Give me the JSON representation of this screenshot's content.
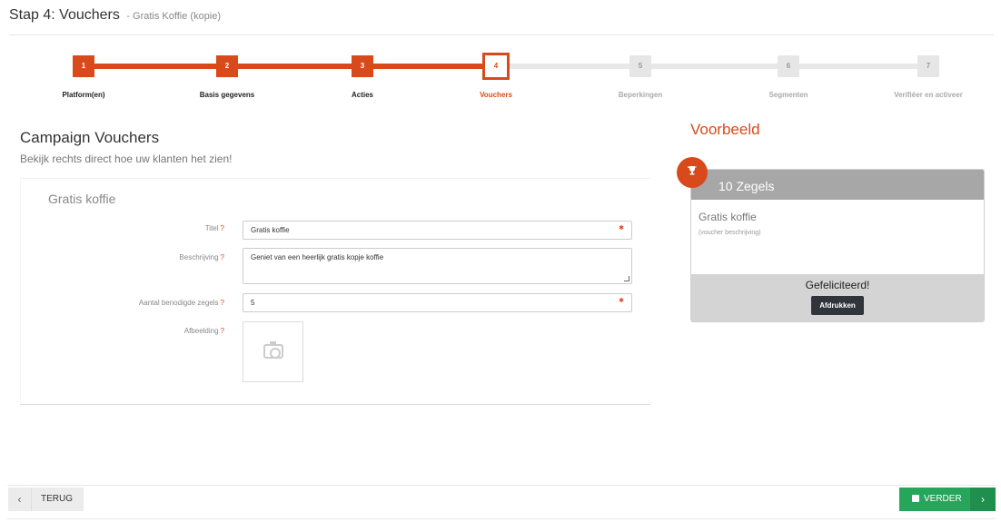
{
  "header": {
    "title": "Stap 4: Vouchers",
    "subtitle": "- Gratis Koffie (kopie)"
  },
  "wizard": {
    "steps": [
      {
        "number": "1",
        "label": "Platform(en)",
        "state": "done"
      },
      {
        "number": "2",
        "label": "Basis gegevens",
        "state": "done"
      },
      {
        "number": "3",
        "label": "Acties",
        "state": "done"
      },
      {
        "number": "4",
        "label": "Vouchers",
        "state": "active"
      },
      {
        "number": "5",
        "label": "Beperkingen",
        "state": "todo"
      },
      {
        "number": "6",
        "label": "Segmenten",
        "state": "todo"
      },
      {
        "number": "7",
        "label": "Verifiëer en activeer",
        "state": "todo"
      }
    ]
  },
  "main": {
    "title": "Campaign Vouchers",
    "subtitle": "Bekijk rechts direct hoe uw klanten het zien!",
    "form": {
      "heading": "Gratis koffie",
      "title_label": "Titel",
      "title_value": "Gratis koffie",
      "description_label": "Beschrijving",
      "description_value": "Geniet van een heerlijk gratis kopje koffie",
      "stamps_label": "Aantal benodigde zegels",
      "stamps_value": "5",
      "image_label": "Afbeelding",
      "help_mark": "?",
      "required_icon": "asterisk-icon"
    }
  },
  "preview": {
    "title": "Voorbeeld",
    "header": "10 Zegels",
    "name": "Gratis koffie",
    "description": "(voucher beschrijving)",
    "congrats": "Gefeliciteerd!",
    "print_label": "Afdrukken",
    "badge_icon": "trophy-icon"
  },
  "footer": {
    "back_label": "TERUG",
    "next_label": "VERDER"
  },
  "colors": {
    "accent": "#d84a1b",
    "success": "#26a65b"
  }
}
